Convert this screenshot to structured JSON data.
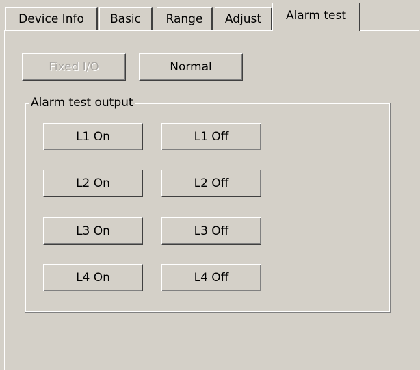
{
  "tabs": [
    {
      "label": "Device Info",
      "active": false
    },
    {
      "label": "Basic",
      "active": false
    },
    {
      "label": "Range",
      "active": false
    },
    {
      "label": "Adjust",
      "active": false
    },
    {
      "label": "Alarm test",
      "active": true
    }
  ],
  "mode_buttons": {
    "fixed_io": {
      "label": "Fixed I/O",
      "enabled": false
    },
    "normal": {
      "label": "Normal",
      "enabled": true
    }
  },
  "alarm_group": {
    "title": "Alarm test output",
    "rows": [
      {
        "on_label": "L1 On",
        "off_label": "L1 Off"
      },
      {
        "on_label": "L2 On",
        "off_label": "L2 Off"
      },
      {
        "on_label": "L3 On",
        "off_label": "L3 Off"
      },
      {
        "on_label": "L4 On",
        "off_label": "L4 Off"
      }
    ]
  },
  "colors": {
    "face": "#d4d0c8",
    "highlight": "#ffffff",
    "shadow": "#808080",
    "dark_shadow": "#404040",
    "disabled_text": "#a8a5a0"
  }
}
